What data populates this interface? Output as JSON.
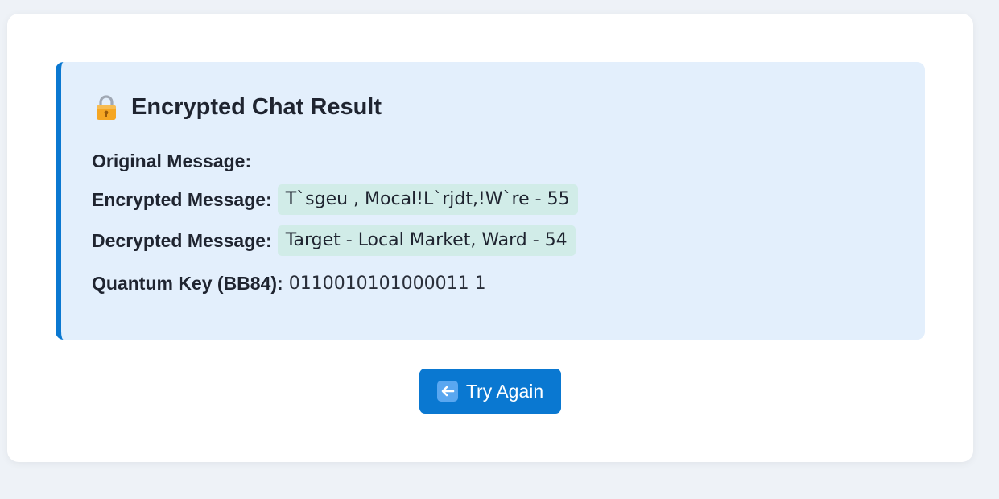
{
  "result": {
    "title": "Encrypted Chat Result",
    "title_icon": "lock-icon",
    "original_label": "Original Message:",
    "original_value": "",
    "encrypted_label": "Encrypted Message:",
    "encrypted_value": "T`sgeu , Mocal!L`rjdt,!W`re - 55",
    "decrypted_label": "Decrypted Message:",
    "decrypted_value": "Target - Local Market, Ward - 54",
    "key_label": "Quantum Key (BB84):",
    "key_value": "0110010101000011 1"
  },
  "button": {
    "label": "Try Again",
    "icon": "back-arrow-icon"
  },
  "colors": {
    "accent": "#0a78d1",
    "result_bg": "#e3effc",
    "pill_bg": "#d1ece8",
    "page_bg": "#eef2f7"
  }
}
